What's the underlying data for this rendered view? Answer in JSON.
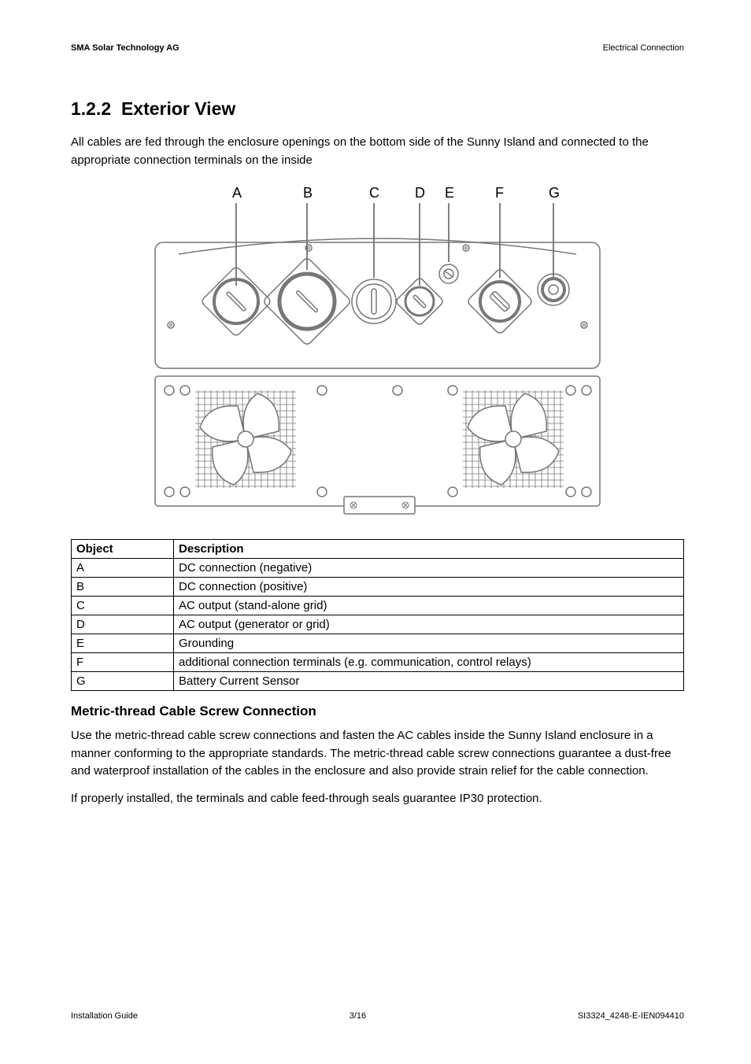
{
  "header": {
    "left": "SMA Solar Technology AG",
    "right": "Electrical Connection"
  },
  "section": {
    "number": "1.2.2",
    "title": "Exterior View"
  },
  "intro": "All cables are fed through the enclosure openings on the bottom side of the Sunny Island and connected to the appropriate connection terminals on the inside",
  "diagram": {
    "labels": [
      "A",
      "B",
      "C",
      "D",
      "E",
      "F",
      "G"
    ]
  },
  "table": {
    "headers": {
      "object": "Object",
      "description": "Description"
    },
    "rows": [
      {
        "object": "A",
        "description": "DC connection (negative)"
      },
      {
        "object": "B",
        "description": "DC connection (positive)"
      },
      {
        "object": "C",
        "description": "AC output (stand-alone grid)"
      },
      {
        "object": "D",
        "description": "AC output (generator or grid)"
      },
      {
        "object": "E",
        "description": "Grounding"
      },
      {
        "object": "F",
        "description": "additional connection terminals (e.g. communication, control relays)"
      },
      {
        "object": "G",
        "description": "Battery Current Sensor"
      }
    ]
  },
  "subsection": {
    "title": "Metric-thread Cable Screw Connection",
    "para1": "Use the metric-thread cable screw connections and fasten the AC cables inside the Sunny Island enclosure in a manner conforming to the appropriate standards. The metric-thread cable screw connections guarantee a dust-free and waterproof installation of the cables in the enclosure and also provide strain relief for the cable connection.",
    "para2": "If properly installed, the terminals and cable feed-through seals guarantee IP30 protection."
  },
  "footer": {
    "left": "Installation Guide",
    "center": "3/16",
    "right": "SI3324_4248-E-IEN094410"
  }
}
